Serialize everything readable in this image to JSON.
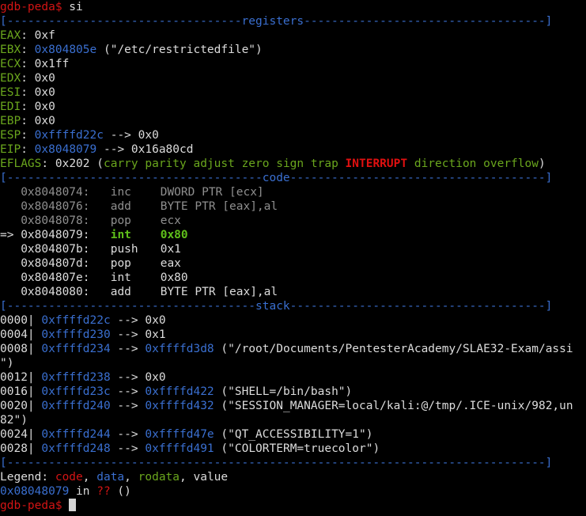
{
  "terminal": {
    "prompt": "gdb-peda$",
    "command": " si",
    "final_prompt": "gdb-peda$"
  },
  "sections": {
    "registers": "[----------------------------------registers-----------------------------------]",
    "code": "[-------------------------------------code-------------------------------------]",
    "stack": "[------------------------------------stack-------------------------------------]",
    "end": "[------------------------------------------------------------------------------]"
  },
  "registers": [
    {
      "name": "EAX",
      "sep": ": ",
      "value": "0xf",
      "value_color": "white",
      "rest": ""
    },
    {
      "name": "EBX",
      "sep": ": ",
      "value": "0x804805e",
      "value_color": "blue",
      "rest": " (\"/etc/restrictedfile\")"
    },
    {
      "name": "ECX",
      "sep": ": ",
      "value": "0x1ff",
      "value_color": "white",
      "rest": ""
    },
    {
      "name": "EDX",
      "sep": ": ",
      "value": "0x0",
      "value_color": "white",
      "rest": ""
    },
    {
      "name": "ESI",
      "sep": ": ",
      "value": "0x0",
      "value_color": "white",
      "rest": ""
    },
    {
      "name": "EDI",
      "sep": ": ",
      "value": "0x0",
      "value_color": "white",
      "rest": ""
    },
    {
      "name": "EBP",
      "sep": ": ",
      "value": "0x0",
      "value_color": "white",
      "rest": ""
    },
    {
      "name": "ESP",
      "sep": ": ",
      "value": "0xffffd22c",
      "value_color": "blue",
      "rest": " --> 0x0"
    },
    {
      "name": "EIP",
      "sep": ": ",
      "value": "0x8048079",
      "value_color": "blue",
      "rest": " --> 0x16a80cd"
    }
  ],
  "eflags": {
    "name": "EFLAGS",
    "sep": ": ",
    "value": "0x202",
    "open": " (",
    "flags_before": "carry parity adjust zero sign trap ",
    "interrupt": "INTERRUPT",
    "flags_after": " direction overflow",
    "close": ")"
  },
  "code": [
    {
      "marker": "   ",
      "addr": "0x8048074:",
      "mnemonic": "inc",
      "operand": "DWORD PTR [ecx]",
      "state": "past"
    },
    {
      "marker": "   ",
      "addr": "0x8048076:",
      "mnemonic": "add",
      "operand": "BYTE PTR [eax],al",
      "state": "past"
    },
    {
      "marker": "   ",
      "addr": "0x8048078:",
      "mnemonic": "pop",
      "operand": "ecx",
      "state": "past"
    },
    {
      "marker": "=> ",
      "addr": "0x8048079:",
      "mnemonic": "int",
      "operand": "0x80",
      "state": "current"
    },
    {
      "marker": "   ",
      "addr": "0x804807b:",
      "mnemonic": "push",
      "operand": "0x1",
      "state": "future"
    },
    {
      "marker": "   ",
      "addr": "0x804807d:",
      "mnemonic": "pop",
      "operand": "eax",
      "state": "future"
    },
    {
      "marker": "   ",
      "addr": "0x804807e:",
      "mnemonic": "int",
      "operand": "0x80",
      "state": "future"
    },
    {
      "marker": "   ",
      "addr": "0x8048080:",
      "mnemonic": "add",
      "operand": "BYTE PTR [eax],al",
      "state": "future"
    }
  ],
  "stack": [
    {
      "offset": "0000|",
      "addr": "0xffffd22c",
      "arrow": " --> ",
      "target": "0x0",
      "target_color": "white",
      "rest": "",
      "cont": ""
    },
    {
      "offset": "0004|",
      "addr": "0xffffd230",
      "arrow": " --> ",
      "target": "0x1",
      "target_color": "white",
      "rest": "",
      "cont": ""
    },
    {
      "offset": "0008|",
      "addr": "0xffffd234",
      "arrow": " --> ",
      "target": "0xffffd3d8",
      "target_color": "blue",
      "rest": " (\"/root/Documents/PentesterAcademy/SLAE32-Exam/assi",
      "cont": "\")"
    },
    {
      "offset": "0012|",
      "addr": "0xffffd238",
      "arrow": " --> ",
      "target": "0x0",
      "target_color": "white",
      "rest": "",
      "cont": ""
    },
    {
      "offset": "0016|",
      "addr": "0xffffd23c",
      "arrow": " --> ",
      "target": "0xffffd422",
      "target_color": "blue",
      "rest": " (\"SHELL=/bin/bash\")",
      "cont": ""
    },
    {
      "offset": "0020|",
      "addr": "0xffffd240",
      "arrow": " --> ",
      "target": "0xffffd432",
      "target_color": "blue",
      "rest": " (\"SESSION_MANAGER=local/kali:@/tmp/.ICE-unix/982,un",
      "cont": "82\")"
    },
    {
      "offset": "0024|",
      "addr": "0xffffd244",
      "arrow": " --> ",
      "target": "0xffffd47e",
      "target_color": "blue",
      "rest": " (\"QT_ACCESSIBILITY=1\")",
      "cont": ""
    },
    {
      "offset": "0028|",
      "addr": "0xffffd248",
      "arrow": " --> ",
      "target": "0xffffd491",
      "target_color": "blue",
      "rest": " (\"COLORTERM=truecolor\")",
      "cont": ""
    }
  ],
  "legend": {
    "label": "Legend: ",
    "code": "code",
    "comma1": ", ",
    "data": "data",
    "comma2": ", ",
    "rodata": "rodata",
    "comma3": ", ",
    "value": "value"
  },
  "location": {
    "addr": "0x08048079",
    "in": " in ",
    "func": "??",
    "args": " ()"
  },
  "colors": {
    "background": "#000000",
    "text": "#dcdcdc",
    "red": "#d21414",
    "blue": "#3a6fd0",
    "green": "#6aa61d",
    "gray": "#8f8f8f"
  }
}
